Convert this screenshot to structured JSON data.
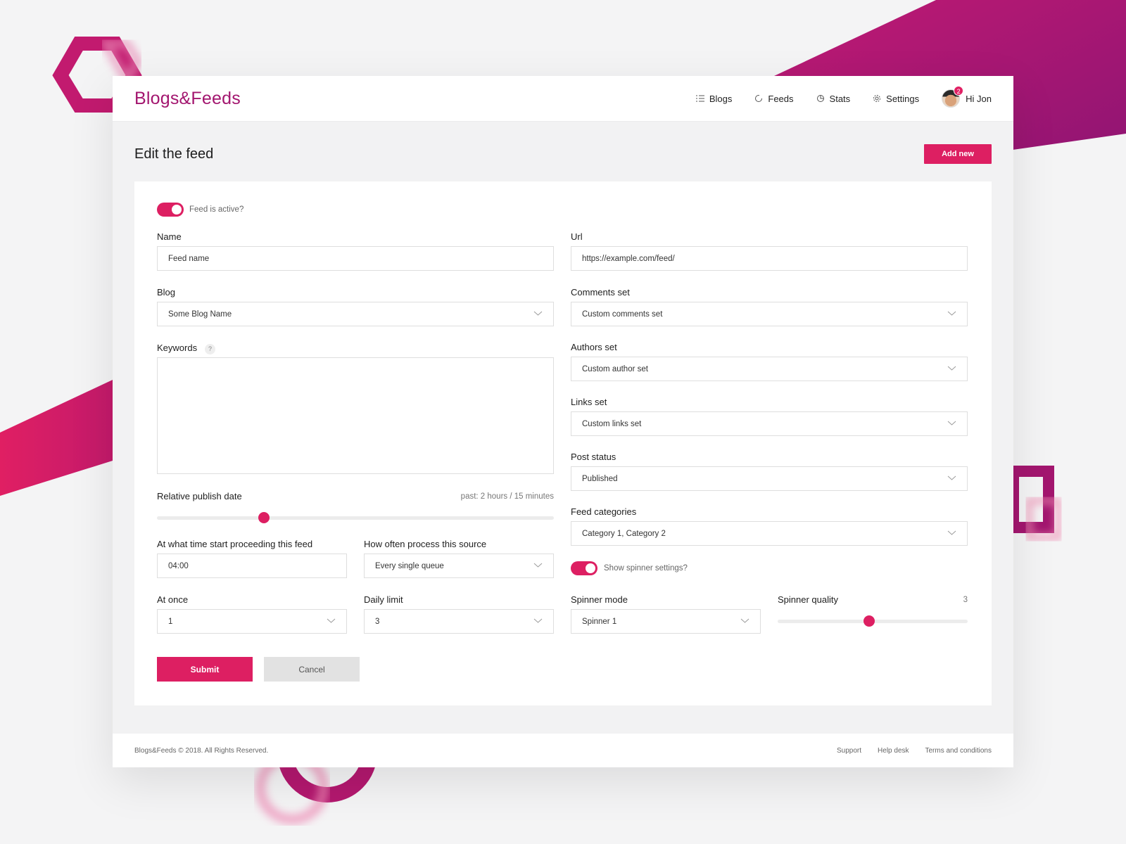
{
  "app": {
    "logo": "Blogs&Feeds"
  },
  "nav": {
    "blogs": "Blogs",
    "feeds": "Feeds",
    "stats": "Stats",
    "settings": "Settings",
    "user_greeting": "Hi Jon",
    "notification_count": "2"
  },
  "page": {
    "title": "Edit the feed",
    "add_new": "Add new"
  },
  "form": {
    "feed_active_label": "Feed is active?",
    "name_label": "Name",
    "name_value": "Feed name",
    "url_label": "Url",
    "url_value": "https://example.com/feed/",
    "blog_label": "Blog",
    "blog_value": "Some Blog Name",
    "comments_label": "Comments set",
    "comments_value": "Custom comments set",
    "keywords_label": "Keywords",
    "keywords_help": "?",
    "authors_label": "Authors set",
    "authors_value": "Custom author set",
    "links_label": "Links set",
    "links_value": "Custom links set",
    "post_status_label": "Post status",
    "post_status_value": "Published",
    "relative_date_label": "Relative publish date",
    "relative_date_value": "past: 2 hours / 15 minutes",
    "relative_date_level": 0.27,
    "feed_categories_label": "Feed categories",
    "feed_categories_value": "Category 1, Category 2",
    "start_time_label": "At what time start proceeding this feed",
    "start_time_value": "04:00",
    "how_often_label": "How often process this source",
    "how_often_value": "Every single queue",
    "spinner_toggle_label": "Show spinner settings?",
    "at_once_label": "At once",
    "at_once_value": "1",
    "daily_limit_label": "Daily limit",
    "daily_limit_value": "3",
    "spinner_mode_label": "Spinner mode",
    "spinner_mode_value": "Spinner 1",
    "spinner_quality_label": "Spinner quality",
    "spinner_quality_value": "3",
    "spinner_quality_level": 0.48,
    "submit": "Submit",
    "cancel": "Cancel"
  },
  "footer": {
    "copyright": "Blogs&Feeds © 2018. All Rights Reserved.",
    "support": "Support",
    "helpdesk": "Help desk",
    "terms": "Terms and conditions"
  },
  "colors": {
    "accent": "#dd1f62",
    "brand": "#a3166f"
  }
}
